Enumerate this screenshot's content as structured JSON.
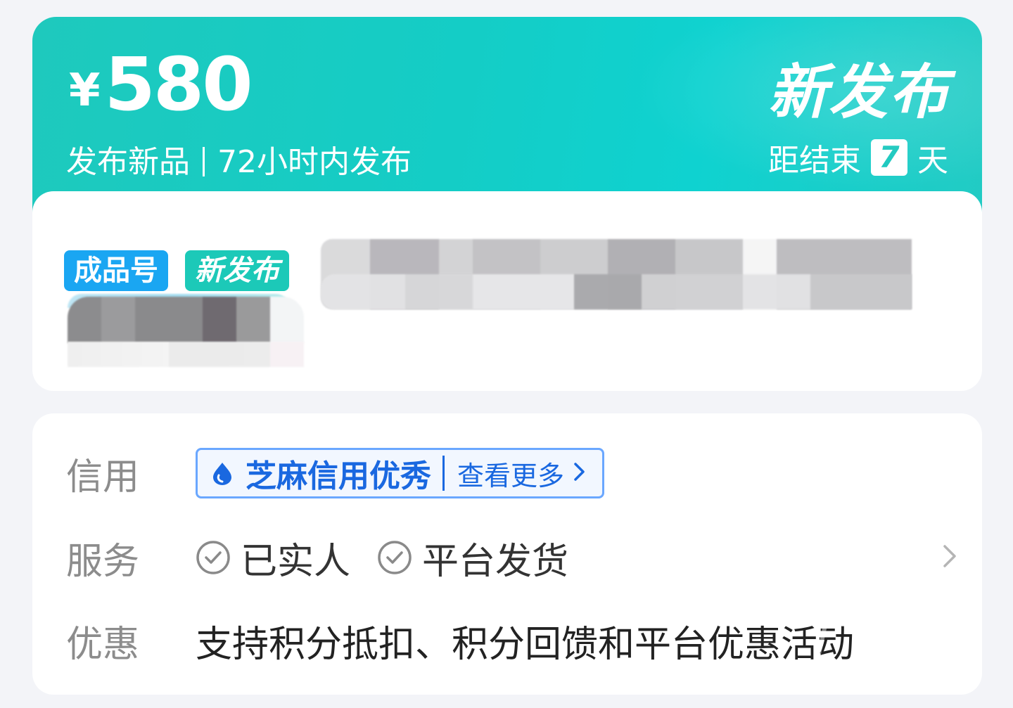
{
  "header": {
    "currency_symbol": "¥",
    "price": "580",
    "subtitle_left": "发布新品",
    "subtitle_right": "72小时内发布",
    "title": "新发布",
    "countdown_prefix": "距结束",
    "countdown_value": "7",
    "countdown_suffix": "天"
  },
  "product": {
    "tags": [
      "成品号",
      "新发布"
    ]
  },
  "info": {
    "credit": {
      "label": "信用",
      "badge_text": "芝麻信用优秀",
      "more_text": "查看更多"
    },
    "service": {
      "label": "服务",
      "items": [
        "已实人",
        "平台发货"
      ]
    },
    "promo": {
      "label": "优惠",
      "text": "支持积分抵扣、积分回馈和平台优惠活动"
    }
  },
  "colors": {
    "banner": "#14cdc6",
    "tag_type": "#1aa6f2",
    "tag_new": "#1cc9b8",
    "credit_blue": "#1a68e0",
    "page_bg": "#f3f4f8"
  },
  "icons": {
    "credit": "water-drop-icon",
    "service": "check-circle-icon",
    "more": "chevron-right-icon"
  }
}
